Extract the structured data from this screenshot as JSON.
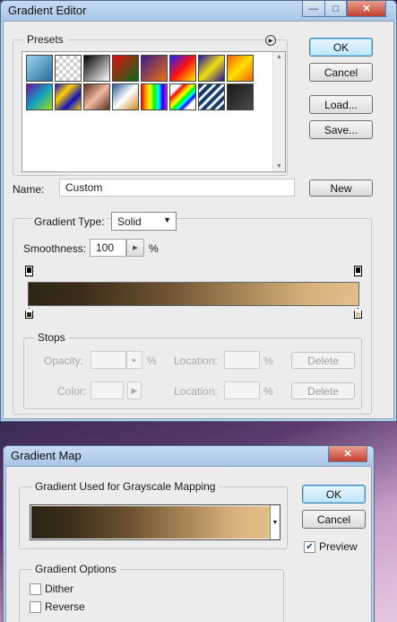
{
  "gradient_editor": {
    "title": "Gradient Editor",
    "presets_label": "Presets",
    "ok": "OK",
    "cancel": "Cancel",
    "load": "Load...",
    "save": "Save...",
    "name_label": "Name:",
    "name_value": "Custom",
    "new": "New",
    "gradient_type_label": "Gradient Type:",
    "gradient_type_value": "Solid",
    "smoothness_label": "Smoothness:",
    "smoothness_value": "100",
    "percent": "%",
    "stops": {
      "label": "Stops",
      "opacity_label": "Opacity:",
      "color_label": "Color:",
      "location_label": "Location:",
      "delete": "Delete"
    },
    "gradient_colors": [
      "#2e2416",
      "#e2be8a"
    ]
  },
  "gradient_map": {
    "title": "Gradient Map",
    "group_label": "Gradient Used for Grayscale Mapping",
    "ok": "OK",
    "cancel": "Cancel",
    "preview_label": "Preview",
    "preview_checked": true,
    "options_label": "Gradient Options",
    "dither_label": "Dither",
    "dither_checked": false,
    "reverse_label": "Reverse",
    "reverse_checked": false
  },
  "presets": [
    "linear-gradient(135deg,#9ad4f0,#2a6c9a)",
    "repeating-conic-gradient(#cfcfcf 0 25%,#fff 0 50%) 0 0/8px 8px",
    "linear-gradient(135deg,#000,#fff)",
    "linear-gradient(135deg,#e01010,#0a6a1a)",
    "linear-gradient(135deg,#3a1a8a,#f07010)",
    "linear-gradient(135deg,#2020ff,#ff1010,#ffee00)",
    "linear-gradient(135deg,#2010a0,#f0e010,#2010a0)",
    "linear-gradient(135deg,#f06010,#ffe000,#f06010)",
    "linear-gradient(135deg,#7010a0,#10a0c0,#a0e010)",
    "linear-gradient(135deg,#1010c0,#ffd000,#1010c0,#ffd000)",
    "linear-gradient(135deg,#5a3020,#f0b8a0,#5a3020)",
    "linear-gradient(135deg,#2a5a90,#ffffff,#d08a20)",
    "linear-gradient(90deg,red,orange,yellow,lime,cyan,blue,magenta)",
    "linear-gradient(135deg,transparent 20%,red,orange,yellow,lime,cyan,blue,transparent 80%)",
    "repeating-linear-gradient(135deg,#1a3a6a 0 4px,#e8f0f8 4px 7px)",
    "linear-gradient(135deg,#1a1a1a,#4a4a4a)"
  ]
}
